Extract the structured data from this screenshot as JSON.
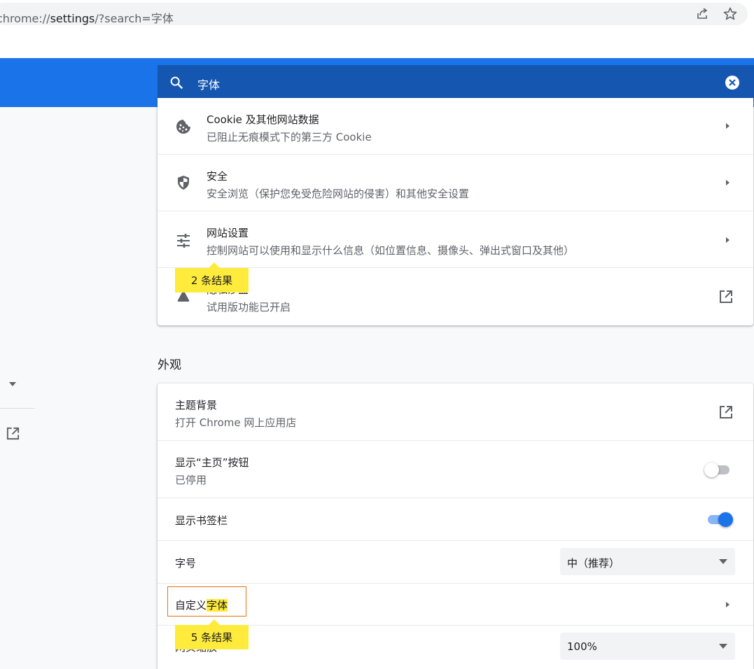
{
  "browser": {
    "url_prefix": "chrome://",
    "url_host": "settings",
    "url_rest": "/?search=字体",
    "share_icon": "share-icon",
    "bookmark_icon": "star-icon"
  },
  "header": {
    "search_value": "字体",
    "search_icon": "search-icon",
    "clear_icon": "clear-icon"
  },
  "privacy_rows": [
    {
      "title": "Cookie 及其他网站数据",
      "subtitle": "已阻止无痕模式下的第三方 Cookie",
      "icon": "cookie-icon"
    },
    {
      "title": "安全",
      "subtitle": "安全浏览（保护您免受危险网站的侵害）和其他安全设置",
      "icon": "shield-icon"
    },
    {
      "title": "网站设置",
      "subtitle": "控制网站可以使用和显示什么信息（如位置信息、摄像头、弹出式窗口及其他）",
      "icon": "tune-icon"
    },
    {
      "title": "隐私沙盒",
      "subtitle": "试用版功能已开启",
      "icon": "flask-icon"
    }
  ],
  "appearance": {
    "section_title": "外观",
    "theme_title": "主题背景",
    "theme_sub": "打开 Chrome 网上应用店",
    "home_title": "显示“主页”按钮",
    "home_sub": "已停用",
    "home_toggle_on": false,
    "bookmarks_title": "显示书签栏",
    "bookmarks_toggle_on": true,
    "font_size_title": "字号",
    "font_size_value": "中（推荐）",
    "custom_fonts_prefix": "自定义",
    "custom_fonts_match": "字体",
    "page_zoom_title": "网页缩放",
    "page_zoom_value": "100%"
  },
  "bubbles": {
    "privacy_results": "2 条结果",
    "fonts_results": "5 条结果"
  },
  "colors": {
    "accent": "#1a73e8",
    "search_bg": "#1557b0",
    "highlight": "#ffeb3b",
    "focus_outline": "#e8710a"
  }
}
